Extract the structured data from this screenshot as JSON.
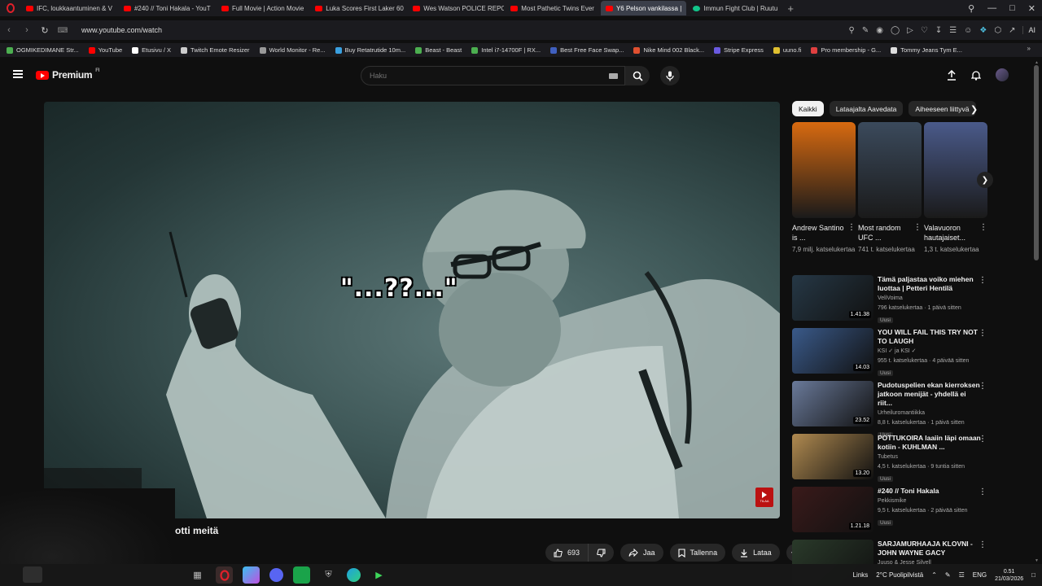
{
  "browser": {
    "tabs": [
      {
        "label": "IFC, loukkaantuminen & V",
        "icon": "red"
      },
      {
        "label": "#240 // Toni Hakala - YouT",
        "icon": "red"
      },
      {
        "label": "Full Movie | Action Movie",
        "icon": "red"
      },
      {
        "label": "Luka Scores First Laker 60",
        "icon": "red"
      },
      {
        "label": "Wes Watson POLICE REPO",
        "icon": "red"
      },
      {
        "label": "Most Pathetic Twins Ever",
        "icon": "red"
      },
      {
        "label": "Y6 Pelson vankilassa |",
        "icon": "red",
        "active": true
      },
      {
        "label": "Immun Fight Club | Ruutu",
        "icon": "green"
      }
    ],
    "url": "www.youtube.com/watch",
    "ai_label": "AI",
    "bookmarks": [
      {
        "label": "OGMIKEDIMANE Str...",
        "color": "#4caf50"
      },
      {
        "label": "YouTube",
        "color": "#ff0000"
      },
      {
        "label": "Etusivu / X",
        "color": "#ffffff"
      },
      {
        "label": "Twitch Emote Resizer",
        "color": "#cccccc"
      },
      {
        "label": "World Monitor - Re...",
        "color": "#999999"
      },
      {
        "label": "Buy Retatrutide 10m...",
        "color": "#3aa0e0"
      },
      {
        "label": "Beast - Beast",
        "color": "#4caf50"
      },
      {
        "label": "Intel i7-14700F | RX...",
        "color": "#4caf50"
      },
      {
        "label": "Best Free Face Swap...",
        "color": "#4060c0"
      },
      {
        "label": "Nike Mind 002 Black...",
        "color": "#e05030"
      },
      {
        "label": "Stripe Express",
        "color": "#6a5ae0"
      },
      {
        "label": "uuno.fi",
        "color": "#e0c030"
      },
      {
        "label": "Pro membership - G...",
        "color": "#e04040"
      },
      {
        "label": "Tommy Jeans Tym E...",
        "color": "#dddddd"
      }
    ]
  },
  "header": {
    "logo_text": "Premium",
    "logo_sup": "FI",
    "search_placeholder": "Haku"
  },
  "video": {
    "overlay_text": "\"...??...\"",
    "title_visible": "otti meitä",
    "badge_label": "TILAA",
    "like_count": "693",
    "share_label": "Jaa",
    "save_label": "Tallenna",
    "download_label": "Lataa"
  },
  "sidebar": {
    "chips": [
      {
        "label": "Kaikki",
        "active": true
      },
      {
        "label": "Lataajalta Aavedata",
        "active": false
      },
      {
        "label": "Aiheeseen liittyvä",
        "active": false
      }
    ],
    "shorts": [
      {
        "title": "Andrew Santino is ...",
        "views": "7,9 milj. katselukertaa",
        "bg": "#d86a10"
      },
      {
        "title": "Most random UFC ...",
        "views": "741 t. katselukertaa",
        "bg": "#3b4a5c"
      },
      {
        "title": "Valavuoron hautajaiset...",
        "views": "1,3 t. katselukertaa",
        "bg": "#4a5a8a"
      }
    ],
    "recommended": [
      {
        "title": "Tämä paljastaa voiko miehen luottaa | Petteri Hentilä",
        "channel": "VeliVoima",
        "meta": "796 katselukertaa · 1 päivä sitten",
        "badge": "Uusi",
        "duration": "1.41.38",
        "bg": "#263846"
      },
      {
        "title": "YOU WILL FAIL THIS TRY NOT TO LAUGH",
        "channel": "KSI ✓ ja KSI ✓",
        "meta": "955 t. katselukertaa · 4 päivää sitten",
        "badge": "Uusi",
        "duration": "14.03",
        "bg": "#3a5a8a"
      },
      {
        "title": "Pudotuspelien ekan kierroksen jatkoon menijät - yhdellä ei riit...",
        "channel": "Urheiluromantiikka",
        "meta": "8,8 t. katselukertaa · 1 päivä sitten",
        "badge": "Uusi",
        "duration": "23.52",
        "bg": "#6a7a9a"
      },
      {
        "title": "POTTUKOIRA laaiin läpi omaan kotiin - KUHLMAN ...",
        "channel": "Tubetus",
        "meta": "4,5 t. katselukertaa · 9 tuntia sitten",
        "badge": "Uusi",
        "duration": "13.20",
        "bg": "#b08a50"
      },
      {
        "title": "#240 // Toni Hakala",
        "channel": "Pekkismike",
        "meta": "9,5 t. katselukertaa · 2 päivää sitten",
        "badge": "Uusi",
        "duration": "1.21.18",
        "bg": "#3a1a1a"
      },
      {
        "title": "SARJAMURHAAJA KLOVNI - JOHN WAYNE GACY",
        "channel": "Juuso & Jesse Silvell",
        "meta": "",
        "badge": "",
        "duration": "",
        "bg": "#2a3a2a"
      }
    ]
  },
  "taskbar": {
    "links_label": "Links",
    "weather": "2°C  Puolipilvistä",
    "lang": "ENG",
    "time": "0.51",
    "date": "21/03/2026"
  }
}
